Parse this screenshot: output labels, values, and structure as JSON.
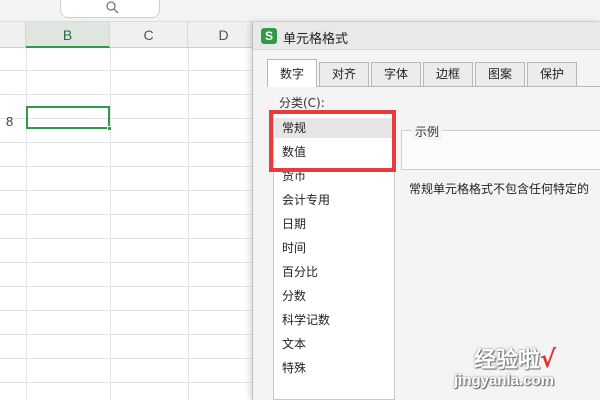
{
  "spreadsheet": {
    "columns": [
      "B",
      "C",
      "D"
    ],
    "active_column": "B",
    "visible_row_number": "8"
  },
  "dialog": {
    "title": "单元格格式",
    "logo_letter": "S",
    "tabs": [
      "数字",
      "对齐",
      "字体",
      "边框",
      "图案",
      "保护"
    ],
    "active_tab": "数字",
    "category_label": "分类(C):",
    "categories": [
      "常规",
      "数值",
      "货币",
      "会计专用",
      "日期",
      "时间",
      "百分比",
      "分数",
      "科学记数",
      "文本",
      "特殊"
    ],
    "selected_category": "常规",
    "sample_label": "示例",
    "description": "常规单元格格式不包含任何特定的"
  },
  "annotation": {
    "highlight_color": "#e83b3b"
  },
  "watermark": {
    "title": "经验啦",
    "check": "√",
    "url": "jingyanla.com"
  },
  "colors": {
    "accent_green": "#2e9b46",
    "highlight_red": "#e83b3b"
  },
  "icons": [
    "search-icon",
    "app-logo-icon"
  ]
}
